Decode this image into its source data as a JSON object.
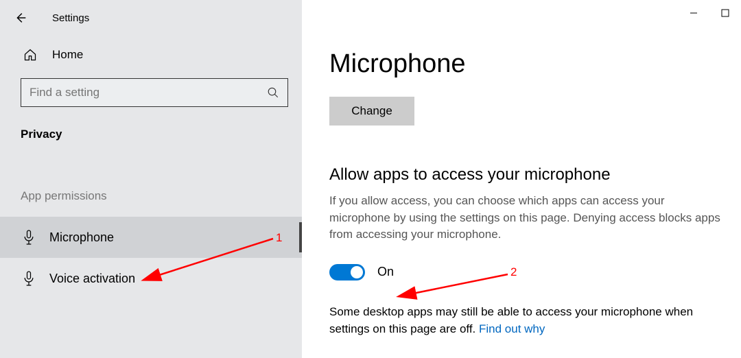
{
  "titlebar": {
    "title": "Settings"
  },
  "sidebar": {
    "home_label": "Home",
    "search_placeholder": "Find a setting",
    "section": "Privacy",
    "subsection": "App permissions",
    "items": [
      {
        "label": "Microphone"
      },
      {
        "label": "Voice activation"
      }
    ]
  },
  "content": {
    "page_title": "Microphone",
    "change_btn": "Change",
    "allow_heading": "Allow apps to access your microphone",
    "allow_desc": "If you allow access, you can choose which apps can access your microphone by using the settings on this page. Denying access blocks apps from accessing your microphone.",
    "toggle_state": "On",
    "note_text": "Some desktop apps may still be able to access your microphone when settings on this page are off. ",
    "note_link": "Find out why"
  },
  "annotations": {
    "label1": "1",
    "label2": "2"
  }
}
